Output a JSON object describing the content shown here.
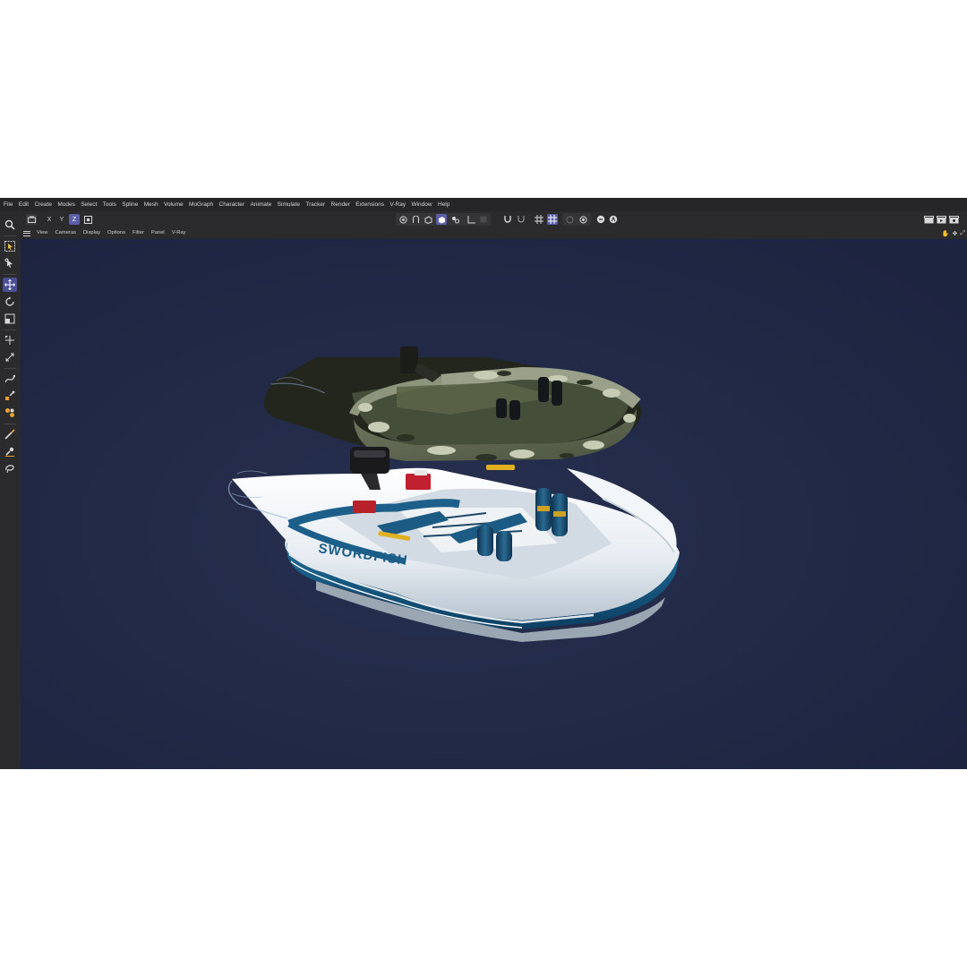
{
  "menubar": {
    "items": [
      "File",
      "Edit",
      "Create",
      "Modes",
      "Select",
      "Tools",
      "Spline",
      "Mesh",
      "Volume",
      "MoGraph",
      "Character",
      "Animate",
      "Simulate",
      "Tracker",
      "Render",
      "Extensions",
      "V-Ray",
      "Window",
      "Help"
    ]
  },
  "toolbar": {
    "axis_x": "X",
    "axis_y": "Y",
    "axis_z": "Z"
  },
  "viewport_menu": {
    "items": [
      "View",
      "Cameras",
      "Display",
      "Options",
      "Filter",
      "Panel",
      "V-Ray"
    ]
  },
  "scene": {
    "boat_label": "SWORDFISH",
    "background_color": "#1f2640",
    "accent_color": "#5a5fa8"
  },
  "icons": {
    "left_toolbar": [
      "search-icon",
      "live-select-icon",
      "select-icon",
      "move-icon",
      "rotate-icon",
      "scale-icon",
      "transform-icon",
      "snap-icon",
      "spline-pen-icon",
      "sculpt-icon",
      "paint-icon",
      "knife-icon",
      "brush-icon"
    ]
  }
}
